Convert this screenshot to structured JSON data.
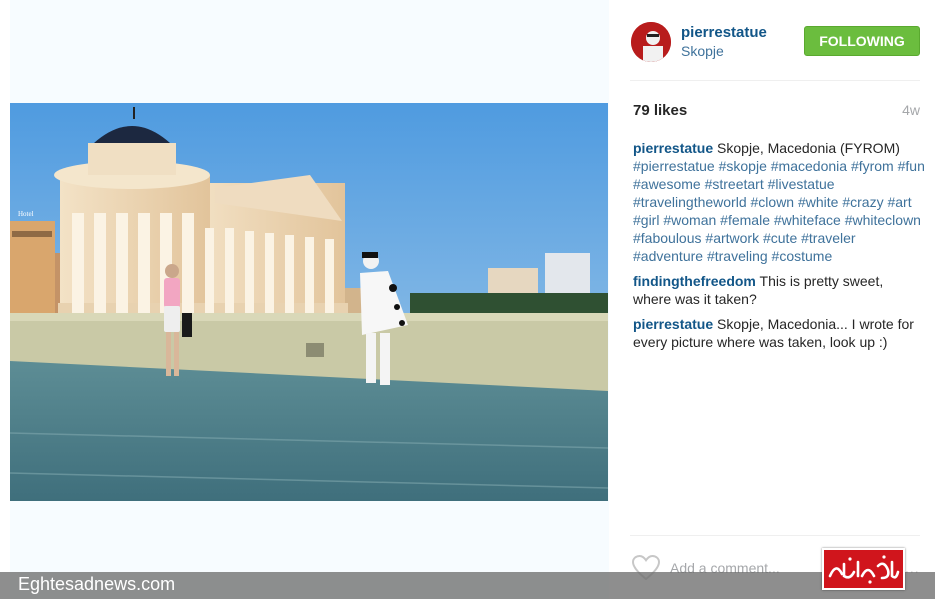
{
  "post": {
    "user": {
      "username": "pierrestatue",
      "location": "Skopje",
      "follow_label": "FOLLOWING",
      "follow_color": "#6bbd3e"
    },
    "likes_text": "79 likes",
    "age_text": "4w",
    "caption": {
      "user": "pierrestatue",
      "text": "Skopje, Macedonia (FYROM)",
      "hashtags": [
        "#pierrestatue",
        "#skopje",
        "#macedonia",
        "#fyrom",
        "#fun",
        "#awesome",
        "#streetart",
        "#livestatue",
        "#travelingtheworld",
        "#clown",
        "#white",
        "#crazy",
        "#art",
        "#girl",
        "#woman",
        "#female",
        "#whiteface",
        "#whiteclown",
        "#faboulous",
        "#artwork",
        "#cute",
        "#traveler",
        "#adventure",
        "#traveling",
        "#costume"
      ]
    },
    "comments": [
      {
        "user": "findingthefreedom",
        "text": "This is pretty sweet, where was it taken?"
      },
      {
        "user": "pierrestatue",
        "text": "Skopje, Macedonia... I wrote for every picture where was taken, look up :)"
      }
    ],
    "add_comment_placeholder": "Add a comment...",
    "more_label": "...",
    "heart_icon": "heart-outline-icon"
  },
  "photo": {
    "sign_text": "Hotel"
  },
  "watermark": {
    "site_name": "Eghtesadnews.com",
    "logo_text": "اقتصادنیوز",
    "logo_color": "#d0151c"
  },
  "colors": {
    "username": "#125688",
    "hashtag": "#3f729b",
    "muted": "#a5a7aa"
  }
}
